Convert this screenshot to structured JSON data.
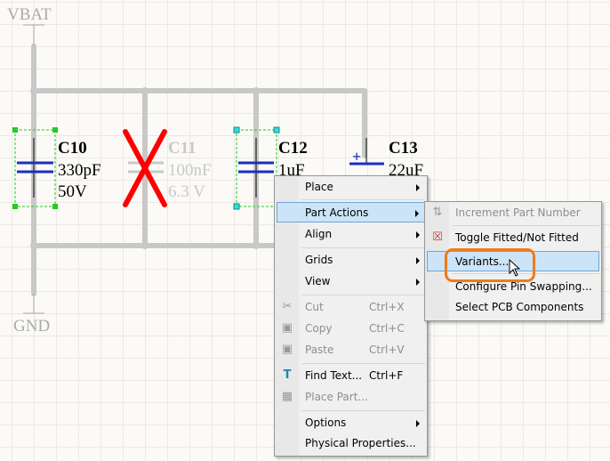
{
  "schematic": {
    "power_label": "VBAT",
    "ground_label": "GND",
    "components": [
      {
        "ref": "C10",
        "value": "330pF",
        "voltage": "50V",
        "state": "selected"
      },
      {
        "ref": "C11",
        "value": "100nF",
        "voltage": "6.3 V",
        "state": "not-fitted"
      },
      {
        "ref": "C12",
        "value": "1uF",
        "state": "selected"
      },
      {
        "ref": "C13",
        "value": "22uF",
        "polarity": "+"
      }
    ]
  },
  "context_menu": {
    "items": [
      {
        "label": "Place",
        "submenu": true
      },
      {
        "label": "Part Actions",
        "submenu": true,
        "highlighted": true
      },
      {
        "label": "Align",
        "submenu": true
      },
      {
        "label": "Grids",
        "submenu": true
      },
      {
        "label": "View",
        "submenu": true
      },
      {
        "label": "Cut",
        "shortcut": "Ctrl+X",
        "disabled": true,
        "icon": "scissors-icon"
      },
      {
        "label": "Copy",
        "shortcut": "Ctrl+C",
        "disabled": true,
        "icon": "copy-icon"
      },
      {
        "label": "Paste",
        "shortcut": "Ctrl+V",
        "disabled": true,
        "icon": "paste-icon"
      },
      {
        "label": "Find Text...",
        "shortcut": "Ctrl+F",
        "icon": "find-text-icon"
      },
      {
        "label": "Place Part...",
        "disabled": true,
        "icon": "place-part-icon"
      },
      {
        "label": "Options",
        "submenu": true
      },
      {
        "label": "Physical Properties..."
      }
    ]
  },
  "submenu": {
    "items": [
      {
        "label": "Increment Part Number",
        "disabled": true,
        "icon": "increment-icon"
      },
      {
        "label": "Toggle Fitted/Not Fitted",
        "icon": "toggle-fitted-icon"
      },
      {
        "label": "Variants...",
        "highlighted": true
      },
      {
        "label": "Configure Pin Swapping..."
      },
      {
        "label": "Select PCB Components"
      }
    ]
  },
  "colors": {
    "highlight": "#cce4f7",
    "callout": "#f07a1a",
    "cap_plate": "#1a2fc0",
    "not_fitted": "#ff0000"
  }
}
